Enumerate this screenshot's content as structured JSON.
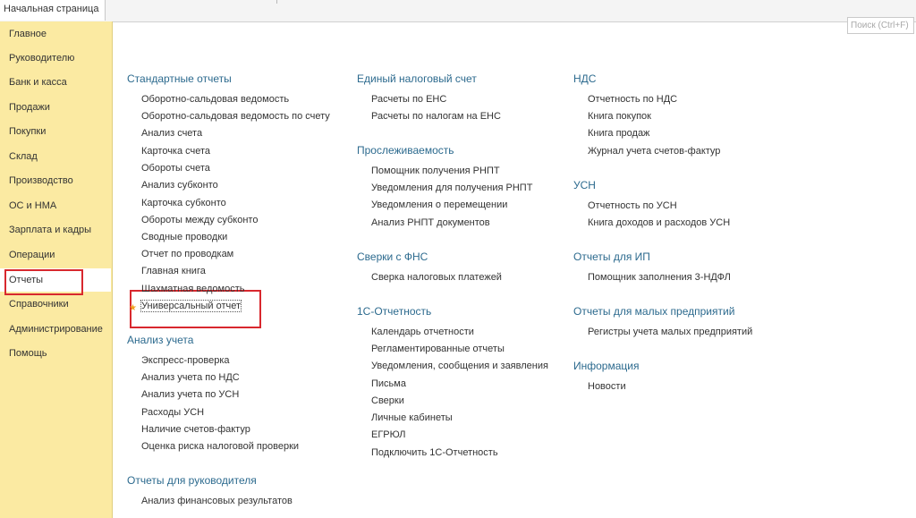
{
  "tabs": {
    "home": "Начальная страница"
  },
  "search": {
    "placeholder": "Поиск (Ctrl+F)"
  },
  "sidebar": {
    "items": [
      {
        "label": "Главное"
      },
      {
        "label": "Руководителю"
      },
      {
        "label": "Банк и касса"
      },
      {
        "label": "Продажи"
      },
      {
        "label": "Покупки"
      },
      {
        "label": "Склад"
      },
      {
        "label": "Производство"
      },
      {
        "label": "ОС и НМА"
      },
      {
        "label": "Зарплата и кадры"
      },
      {
        "label": "Операции"
      },
      {
        "label": "Отчеты"
      },
      {
        "label": "Справочники"
      },
      {
        "label": "Администрирование"
      },
      {
        "label": "Помощь"
      }
    ]
  },
  "colors": {
    "sidebar": "#fbeaa2",
    "section_title": "#2c6a8e",
    "highlight": "#d8282e",
    "star": "#f0a020"
  },
  "columns": [
    {
      "sections": [
        {
          "title": "Стандартные отчеты",
          "items": [
            "Оборотно-сальдовая ведомость",
            "Оборотно-сальдовая ведомость по счету",
            "Анализ счета",
            "Карточка счета",
            "Обороты счета",
            "Анализ субконто",
            "Карточка субконто",
            "Обороты между субконто",
            "Сводные проводки",
            "Отчет по проводкам",
            "Главная книга",
            "Шахматная ведомость",
            "Универсальный отчет"
          ]
        },
        {
          "title": "Анализ учета",
          "items": [
            "Экспресс-проверка",
            "Анализ учета по НДС",
            "Анализ учета по УСН",
            "Расходы УСН",
            "Наличие счетов-фактур",
            "Оценка риска налоговой проверки"
          ]
        },
        {
          "title": "Отчеты для руководителя",
          "items": [
            "Анализ финансовых результатов"
          ]
        }
      ]
    },
    {
      "sections": [
        {
          "title": "Единый налоговый счет",
          "items": [
            "Расчеты по ЕНС",
            "Расчеты по налогам на ЕНС"
          ]
        },
        {
          "title": "Прослеживаемость",
          "items": [
            "Помощник получения РНПТ",
            "Уведомления для получения РНПТ",
            "Уведомления о перемещении",
            "Анализ РНПТ документов"
          ]
        },
        {
          "title": "Сверки с ФНС",
          "items": [
            "Сверка налоговых платежей"
          ]
        },
        {
          "title": "1С-Отчетность",
          "items": [
            "Календарь отчетности",
            "Регламентированные отчеты",
            "Уведомления, сообщения и заявления",
            "Письма",
            "Сверки",
            "Личные кабинеты",
            "ЕГРЮЛ",
            "Подключить 1С-Отчетность"
          ]
        }
      ]
    },
    {
      "sections": [
        {
          "title": "НДС",
          "items": [
            "Отчетность по НДС",
            "Книга покупок",
            "Книга продаж",
            "Журнал учета счетов-фактур"
          ]
        },
        {
          "title": "УСН",
          "items": [
            "Отчетность по УСН",
            "Книга доходов и расходов УСН"
          ]
        },
        {
          "title": "Отчеты для ИП",
          "items": [
            "Помощник заполнения 3-НДФЛ"
          ]
        },
        {
          "title": "Отчеты для малых предприятий",
          "items": [
            "Регистры учета малых предприятий"
          ]
        },
        {
          "title": "Информация",
          "items": [
            "Новости"
          ]
        }
      ]
    }
  ]
}
